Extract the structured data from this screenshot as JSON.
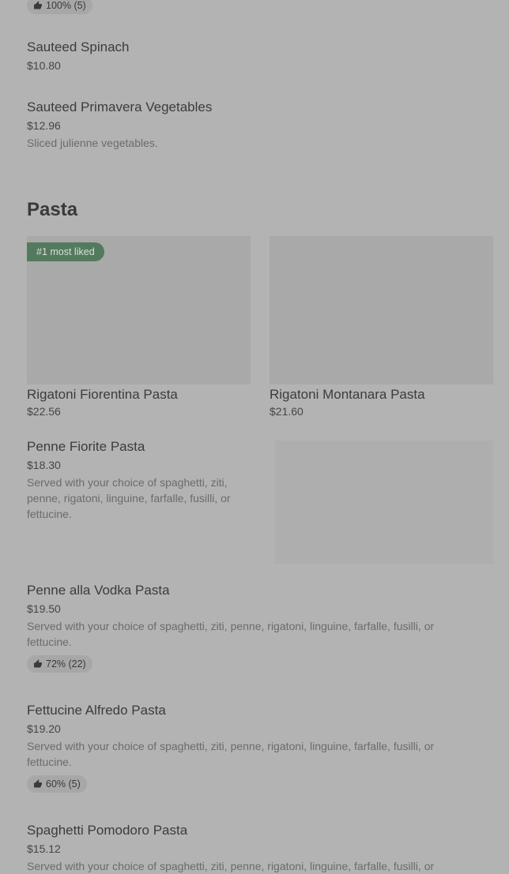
{
  "top_rating": "100% (5)",
  "sides": [
    {
      "name": "Sauteed Spinach",
      "price": "$10.80"
    },
    {
      "name": "Sauteed Primavera Vegetables",
      "price": "$12.96",
      "description": "Sliced julienne vegetables."
    }
  ],
  "pasta": {
    "title": "Pasta",
    "cards": [
      {
        "name": "Rigatoni Fiorentina Pasta",
        "price": "$22.56",
        "badge": "#1 most liked"
      },
      {
        "name": "Rigatoni Montanara Pasta",
        "price": "$21.60"
      }
    ],
    "items": [
      {
        "name": "Penne Fiorite Pasta",
        "price": "$18.30",
        "description": "Served with your choice of spaghetti, ziti, penne, rigatoni, linguine, farfalle, fusilli, or fettucine."
      },
      {
        "name": "Penne alla Vodka Pasta",
        "price": "$19.50",
        "description": "Served with your choice of spaghetti, ziti, penne, rigatoni, linguine, farfalle, fusilli, or fettucine.",
        "rating": "72% (22)"
      },
      {
        "name": "Fettucine Alfredo Pasta",
        "price": "$19.20",
        "description": "Served with your choice of spaghetti, ziti, penne, rigatoni, linguine, farfalle, fusilli, or fettucine.",
        "rating": "60% (5)"
      },
      {
        "name": "Spaghetti Pomodoro Pasta",
        "price": "$15.12",
        "description": "Served with your choice of spaghetti, ziti, penne, rigatoni, linguine, farfalle, fusilli, or"
      }
    ]
  },
  "icons": {
    "rating": "thumbs-up-icon"
  },
  "colors": {
    "background": "#b3b3b3",
    "badge": "#547a5e",
    "pill": "#a7a7a7"
  }
}
